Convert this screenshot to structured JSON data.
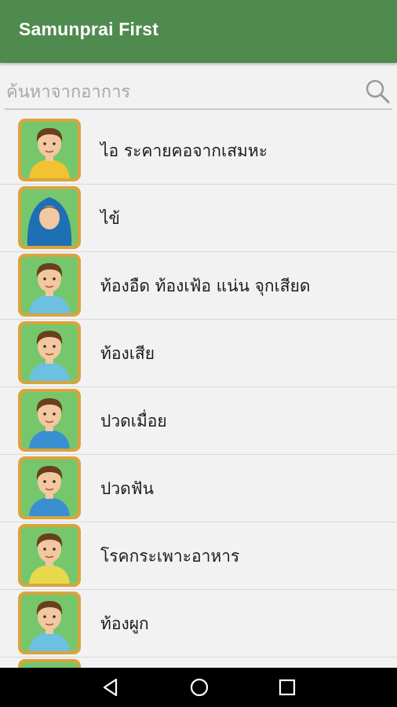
{
  "app": {
    "title": "Samunprai First",
    "accent": "#4f8a4f"
  },
  "search": {
    "placeholder": "ค้นหาจากอาการ",
    "value": "",
    "icon": "search-icon"
  },
  "symptoms": [
    {
      "label": "ไอ ระคายคอจากเสมหะ",
      "icon": "coughing-person-icon"
    },
    {
      "label": "ไข้",
      "icon": "fever-person-blanket-icon"
    },
    {
      "label": "ท้องอืด ท้องเฟ้อ แน่น จุกเสียด",
      "icon": "bloated-stomach-person-icon"
    },
    {
      "label": "ท้องเสีย",
      "icon": "diarrhea-person-toilet-icon"
    },
    {
      "label": "ปวดเมื่อย",
      "icon": "muscle-ache-person-icon"
    },
    {
      "label": "ปวดฟัน",
      "icon": "toothache-person-icon"
    },
    {
      "label": "โรคกระเพาะอาหาร",
      "icon": "stomach-disease-person-icon"
    },
    {
      "label": "ท้องผูก",
      "icon": "constipation-person-toilet-icon"
    },
    {
      "label": "",
      "icon": "person-icon"
    }
  ],
  "navbar": {
    "back": "back-icon",
    "home": "home-icon",
    "recents": "recents-icon"
  }
}
